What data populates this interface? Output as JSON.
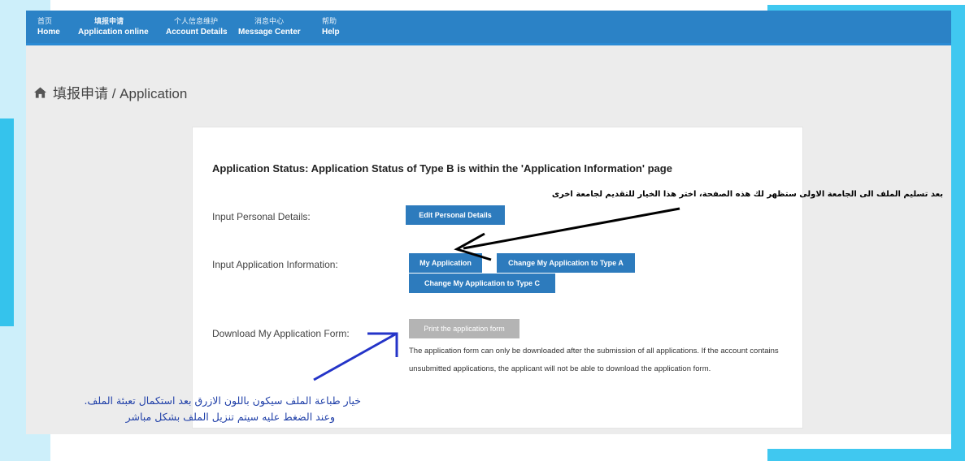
{
  "nav": [
    {
      "zh": "首页",
      "en": "Home"
    },
    {
      "zh": "填报申请",
      "en": "Application online"
    },
    {
      "zh": "个人信息维护",
      "en": "Account Details"
    },
    {
      "zh": "消息中心",
      "en": "Message Center"
    },
    {
      "zh": "帮助",
      "en": "Help"
    }
  ],
  "breadcrumb": "填报申请 / Application",
  "panel": {
    "status_title": "Application Status: Application Status of Type B is within the 'Application Information' page",
    "personal_label": "Input Personal Details:",
    "edit_button": "Edit Personal Details",
    "application_label": "Input Application Information:",
    "my_application_button": "My Application",
    "change_type_a_button": "Change My Application to Type A",
    "change_type_c_button": "Change My Application to Type C",
    "download_label": "Download My Application Form:",
    "print_button": "Print the application form",
    "note": "The application form can only be downloaded after the submission of all applications. If the account contains unsubmitted applications, the applicant will not be able to download the application form."
  },
  "annotations": {
    "arabic_top": "بعد تسليم الملف الى الجامعة الاولى ستظهر لك هذه الصفحة، اختر هذا الخيار للتقديم لجامعة اخرى",
    "arabic_bottom_line1": "خيار طباعة الملف سيكون باللون الازرق بعد استكمال تعبئة الملف.",
    "arabic_bottom_line2": "وعند الضغط عليه سيتم تنزيل الملف بشكل مباشر"
  },
  "colors": {
    "navbar": "#2b82c6",
    "button": "#2d7bbd",
    "button_disabled": "#b4b4b4",
    "frame_accent": "#40c8f0",
    "arrow_black": "#000000",
    "arrow_blue": "#2434c8"
  }
}
